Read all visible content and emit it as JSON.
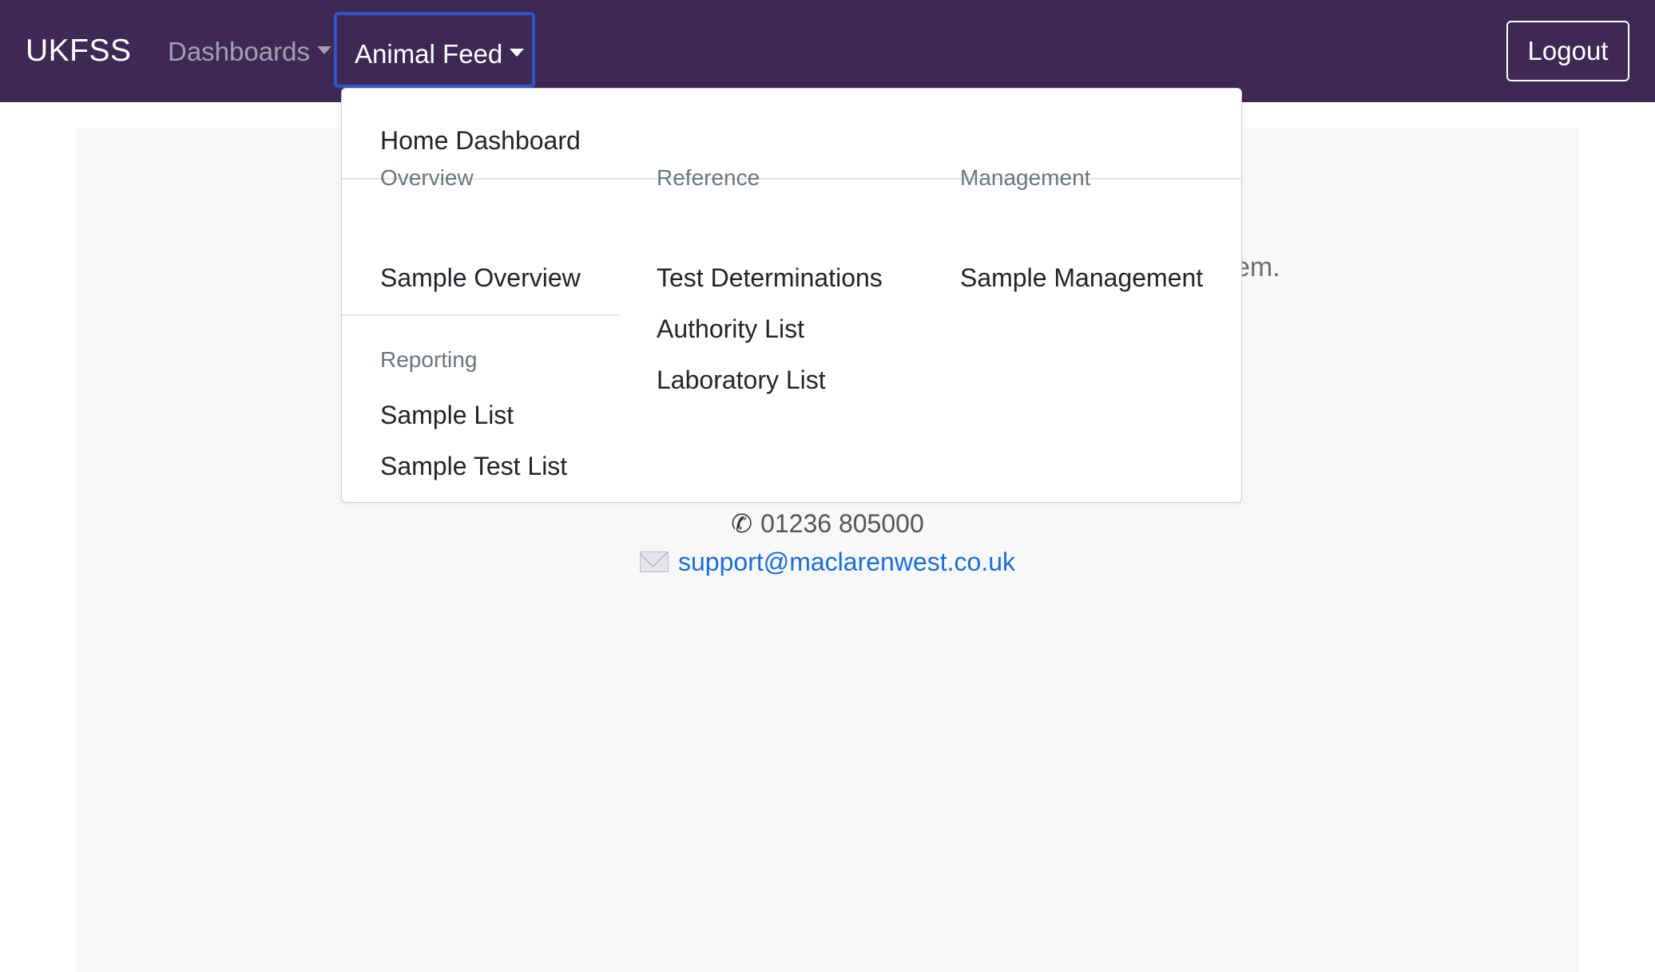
{
  "navbar": {
    "brand": "UKFSS",
    "items": [
      {
        "label": "Dashboards"
      },
      {
        "label": "Animal Feed"
      }
    ],
    "logout_label": "Logout"
  },
  "dropdown": {
    "home": "Home Dashboard",
    "overview": {
      "header": "Overview",
      "items": [
        "Sample Overview"
      ]
    },
    "reporting": {
      "header": "Reporting",
      "items": [
        "Sample List",
        "Sample Test List"
      ]
    },
    "reference": {
      "header": "Reference",
      "items": [
        "Test Determinations",
        "Authority List",
        "Laboratory List"
      ]
    },
    "management": {
      "header": "Management",
      "items": [
        "Sample Management"
      ]
    }
  },
  "main": {
    "partial_text": "em.",
    "phone": "01236 805000",
    "email": "support@maclarenwest.co.uk"
  },
  "colors": {
    "navbar_bg": "#3d2953",
    "focus_ring": "#2f54c8",
    "link": "#1a6ed8"
  },
  "icons": {
    "phone": "telephone-icon",
    "email": "envelope-icon",
    "dropdown": "caret-down-icon"
  }
}
